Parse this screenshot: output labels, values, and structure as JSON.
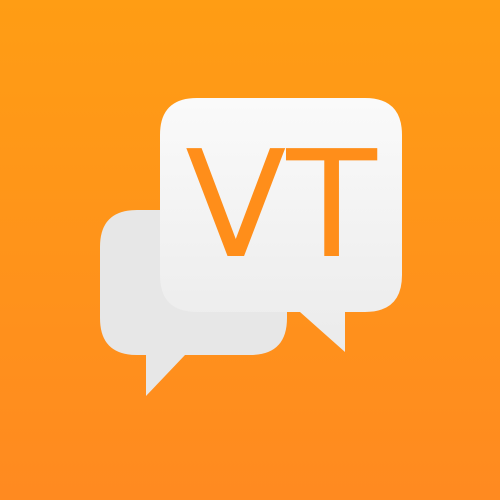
{
  "logo": {
    "text": "VT",
    "bubble_color": "#F3F3F3",
    "bubble_shade_color": "#E6E6E6",
    "text_color": "#FF8E1A",
    "background_top": "#FF9D14",
    "background_bottom": "#FF8A20"
  }
}
